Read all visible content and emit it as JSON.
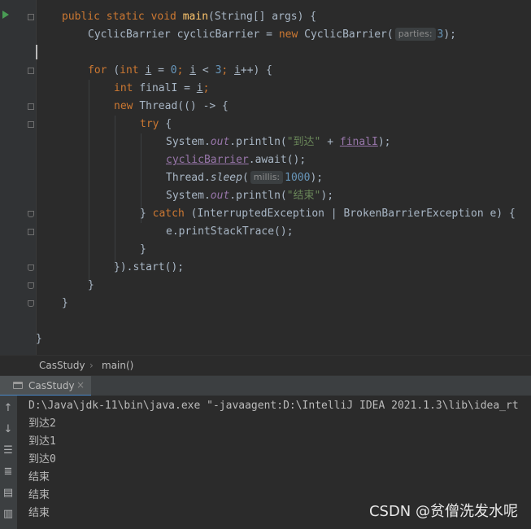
{
  "editor": {
    "lines": [
      [
        [
          "kw",
          "public static void "
        ],
        [
          "fn",
          "main"
        ],
        [
          "",
          "(String[] args) {"
        ]
      ],
      [
        [
          "",
          "CyclicBarrier cyclicBarrier = "
        ],
        [
          "kw",
          "new "
        ],
        [
          "",
          "CyclicBarrier("
        ],
        [
          "hint",
          "parties:"
        ],
        [
          "num",
          "3"
        ],
        [
          "",
          ");"
        ]
      ],
      [],
      [
        [
          "kw",
          "for "
        ],
        [
          "",
          "("
        ],
        [
          "kw",
          "int "
        ],
        [
          "ul",
          "i"
        ],
        [
          "",
          " = "
        ],
        [
          "num",
          "0"
        ],
        [
          "kw",
          "; "
        ],
        [
          "ul",
          "i"
        ],
        [
          "",
          " < "
        ],
        [
          "num",
          "3"
        ],
        [
          "kw",
          "; "
        ],
        [
          "ul",
          "i"
        ],
        [
          "",
          "++) {"
        ]
      ],
      [
        [
          "kw",
          "int "
        ],
        [
          "",
          "finalI = "
        ],
        [
          "ul",
          "i"
        ],
        [
          "kw",
          ";"
        ]
      ],
      [
        [
          "kw",
          "new "
        ],
        [
          "",
          "Thread(() -> {"
        ]
      ],
      [
        [
          "kw",
          "try "
        ],
        [
          "",
          "{"
        ]
      ],
      [
        [
          "",
          "System."
        ],
        [
          "fld",
          "out"
        ],
        [
          "",
          ".println("
        ],
        [
          "str",
          "\"到达\""
        ],
        [
          "",
          " + "
        ],
        [
          "field-ul",
          "finalI"
        ],
        [
          "",
          ");"
        ]
      ],
      [
        [
          "field-ul",
          "cyclicBarrier"
        ],
        [
          "",
          ".await();"
        ]
      ],
      [
        [
          "",
          "Thread."
        ],
        [
          "it",
          "sleep"
        ],
        [
          "",
          "("
        ],
        [
          "hint",
          "millis:"
        ],
        [
          "num",
          "1000"
        ],
        [
          "",
          ");"
        ]
      ],
      [
        [
          "",
          "System."
        ],
        [
          "fld",
          "out"
        ],
        [
          "",
          ".println("
        ],
        [
          "str",
          "\"结束\""
        ],
        [
          "",
          ");"
        ]
      ],
      [
        [
          "",
          "} "
        ],
        [
          "kw",
          "catch "
        ],
        [
          "",
          "(InterruptedException | BrokenBarrierException e) {"
        ]
      ],
      [
        [
          "",
          "e.printStackTrace();"
        ]
      ],
      [
        [
          "",
          "}"
        ]
      ],
      [
        [
          "",
          "}).start();"
        ]
      ],
      [
        [
          "",
          "}"
        ]
      ],
      [
        [
          "",
          "}"
        ]
      ],
      [],
      [
        [
          "",
          "}"
        ]
      ]
    ]
  },
  "breadcrumb": {
    "class_name": "CasStudy",
    "method_name": "main()"
  },
  "run_panel": {
    "tab_label": "CasStudy",
    "close_symbol": "×",
    "output": [
      "D:\\Java\\jdk-11\\bin\\java.exe \"-javaagent:D:\\IntelliJ IDEA 2021.1.3\\lib\\idea_rt",
      "到达2",
      "到达1",
      "到达0",
      "结束",
      "结束",
      "结束"
    ]
  },
  "watermark": "CSDN @贫僧洗发水呢",
  "icons": [
    "run-gutter-icon",
    "fold-marker-icon",
    "arrow-up-icon",
    "arrow-down-icon",
    "soft-wrap-icon",
    "scroll-to-end-icon",
    "print-icon",
    "trash-icon"
  ]
}
